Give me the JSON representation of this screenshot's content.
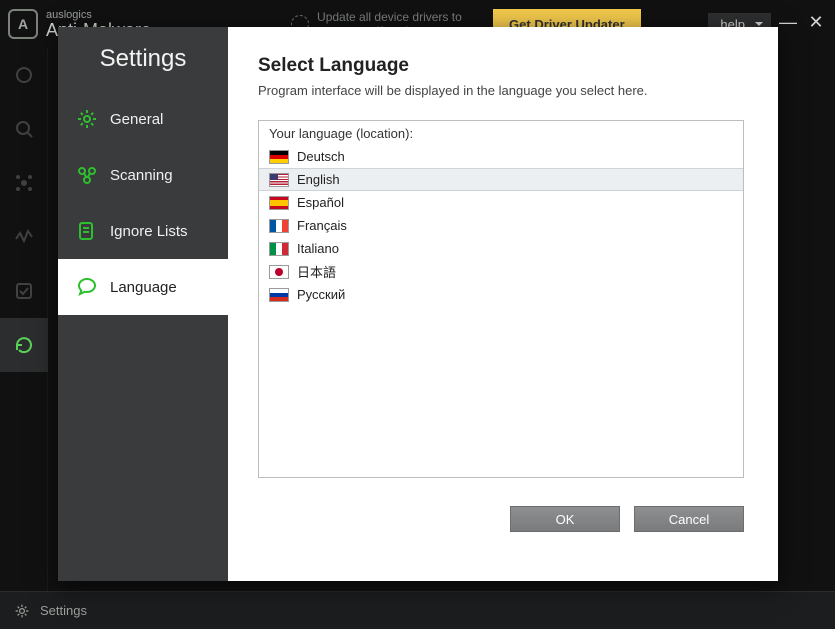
{
  "titlebar": {
    "brand_small": "auslogics",
    "brand_big": "Anti-Malware",
    "update_tip": "Update all device drivers to prevent malfunctions",
    "cta": "Get Driver Updater",
    "help": "help"
  },
  "statusbar": {
    "settings": "Settings"
  },
  "dialog": {
    "sidebar_title": "Settings",
    "nav": {
      "general": "General",
      "scanning": "Scanning",
      "ignore": "Ignore Lists",
      "language": "Language"
    },
    "page": {
      "title": "Select Language",
      "desc": "Program interface will be displayed in the language you select here.",
      "list_label": "Your language (location):",
      "languages": {
        "de": "Deutsch",
        "en": "English",
        "es": "Español",
        "fr": "Français",
        "it": "Italiano",
        "ja": "日本語",
        "ru": "Русский"
      },
      "selected": "en"
    },
    "buttons": {
      "ok": "OK",
      "cancel": "Cancel"
    }
  }
}
